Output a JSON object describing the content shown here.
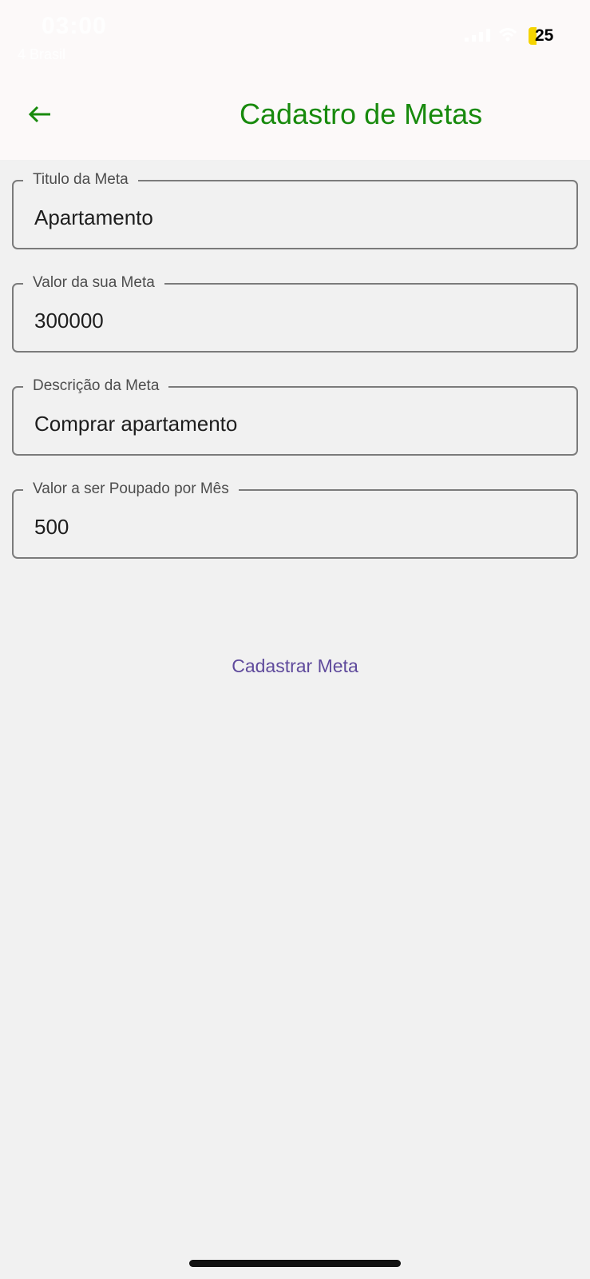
{
  "status_bar": {
    "time": "03:00",
    "subtitle": "4 Brasil",
    "battery": "25",
    "battery_color": "#f5d400"
  },
  "app_bar": {
    "title": "Cadastro de Metas",
    "back_icon": "arrow-left-icon",
    "title_color": "#188a0d"
  },
  "form": {
    "fields": [
      {
        "label": "Titulo da Meta",
        "value": "Apartamento"
      },
      {
        "label": "Valor da sua Meta",
        "value": "300000"
      },
      {
        "label": "Descrição da Meta",
        "value": "Comprar apartamento"
      },
      {
        "label": "Valor a ser Poupado por Mês",
        "value": "500"
      }
    ],
    "submit_label": "Cadastrar Meta",
    "submit_color": "#5f4a9c"
  }
}
